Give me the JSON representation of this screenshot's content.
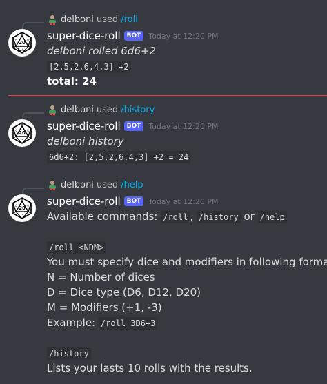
{
  "messages": [
    {
      "reply_user": "delboni",
      "reply_used": "used",
      "reply_cmd": "/roll",
      "username": "super-dice-roll",
      "bot_tag": "BOT",
      "timestamp": "Today at 12:20 PM",
      "line1": "delboni rolled 6d6+2",
      "line2": "[2,5,2,6,4,3] +2",
      "line3": "total: 24"
    },
    {
      "reply_user": "delboni",
      "reply_used": "used",
      "reply_cmd": "/history",
      "username": "super-dice-roll",
      "bot_tag": "BOT",
      "timestamp": "Today at 12:20 PM",
      "line1": "delboni history",
      "line2": "6d6+2: [2,5,2,6,4,3] +2 = 24"
    },
    {
      "reply_user": "delboni",
      "reply_used": "used",
      "reply_cmd": "/help",
      "username": "super-dice-roll",
      "bot_tag": "BOT",
      "timestamp": "Today at 12:20 PM",
      "available_prefix": "Available commands:",
      "cmd_roll": "/roll",
      "comma": ",",
      "cmd_history": "/history",
      "or": "or",
      "cmd_help": "/help",
      "roll_syntax": "/roll <NDM>",
      "format_text": "You must specify dice and modifiers in following format:",
      "n_text": "N = Number of dices",
      "d_text": "D = Dice type (D6, D12, D20)",
      "m_text": "M = Modifiers (+1, -3)",
      "example_prefix": "Example:",
      "example_code": "/roll 3D6+3",
      "history_code": "/history",
      "history_desc": "Lists your lasts 10 rolls with the results."
    }
  ]
}
